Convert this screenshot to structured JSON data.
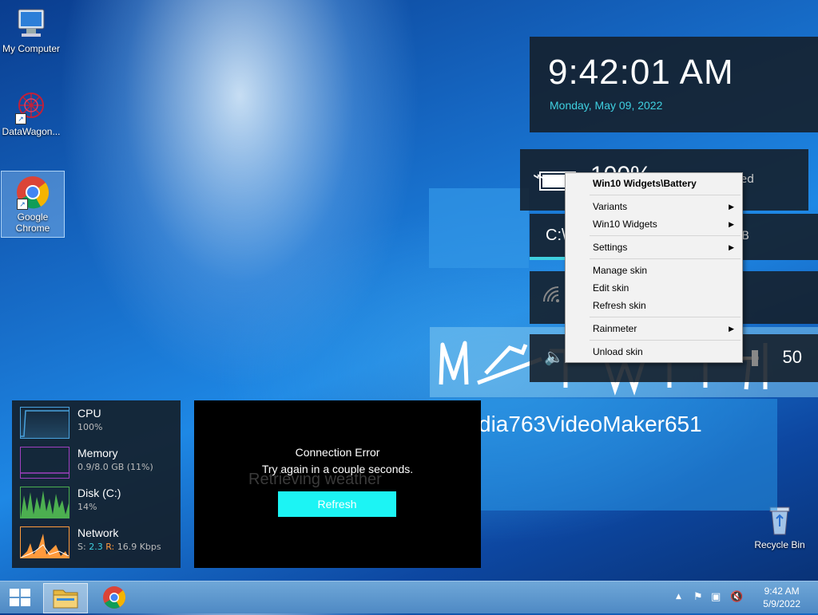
{
  "desktop": {
    "icons": [
      {
        "label": "My Computer"
      },
      {
        "label": "DataWagon..."
      },
      {
        "label": "Google Chrome"
      },
      {
        "label": "Recycle Bin"
      }
    ]
  },
  "clock": {
    "time": "9:42:01 AM",
    "date": "Monday, May 09, 2022"
  },
  "battery": {
    "percent": "100%",
    "status": "ed"
  },
  "disk_widget": {
    "label": "C:\\",
    "size": "B"
  },
  "volume": {
    "value": "50",
    "level": 0.5
  },
  "media_text": "dia763VideoMaker651",
  "context_menu": {
    "title": "Win10 Widgets\\Battery",
    "items": [
      "Variants",
      "Win10 Widgets",
      "Settings",
      "Manage skin",
      "Edit skin",
      "Refresh skin",
      "Rainmeter",
      "Unload skin"
    ]
  },
  "sysmon": {
    "cpu": {
      "name": "CPU",
      "value": "100%"
    },
    "memory": {
      "name": "Memory",
      "value": "0.9/8.0 GB (11%)"
    },
    "disk": {
      "name": "Disk (C:)",
      "value": "14%"
    },
    "network": {
      "name": "Network",
      "s_label": "S:",
      "s_value": "2.3",
      "r_label": "R:",
      "r_value": "16.9 Kbps"
    }
  },
  "weather": {
    "ghost_text": "Retrieving weather",
    "error_title": "Connection Error",
    "error_message": "Try again in a couple seconds.",
    "refresh_label": "Refresh"
  },
  "taskbar": {
    "time": "9:42 AM",
    "date": "5/9/2022"
  },
  "colors": {
    "accent_cyan": "#1cf4f4",
    "date_cyan": "#3fd0e0",
    "cpu": "#4aa3df",
    "memory": "#a040c0",
    "disk": "#4caf50",
    "network": "#ff9a3c"
  }
}
